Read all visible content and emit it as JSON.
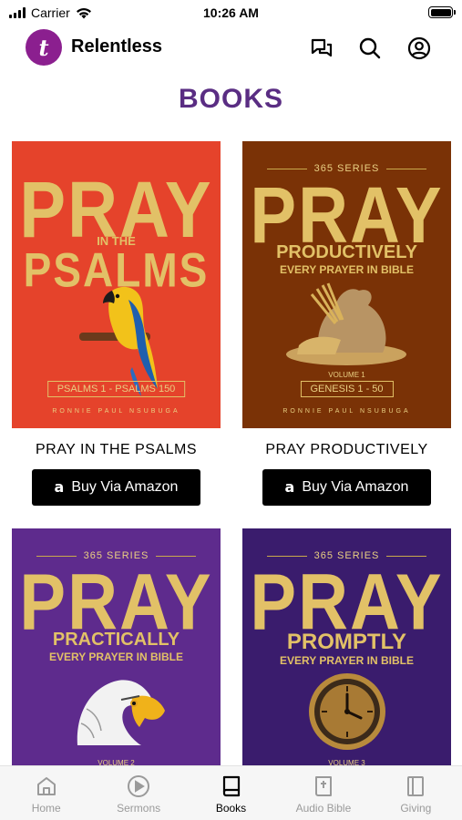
{
  "status_bar": {
    "carrier": "Carrier",
    "time": "10:26 AM"
  },
  "header": {
    "app_name": "Relentless",
    "logo_glyph": "t"
  },
  "page": {
    "title": "BOOKS"
  },
  "books": [
    {
      "title": "PRAY IN THE PSALMS",
      "button": "Buy Via Amazon",
      "cover": {
        "bg": "#e5432b",
        "series": "",
        "word": "PRAY",
        "subtitle": "IN THE",
        "subtitle2": "PSALMS",
        "volume": "",
        "range": "PSALMS 1 - PSALMS 150",
        "author": "RONNIE PAUL NSUBUGA",
        "art": "parrot-icon"
      }
    },
    {
      "title": "PRAY PRODUCTIVELY",
      "button": "Buy Via Amazon",
      "cover": {
        "bg": "#7a3206",
        "series": "365 SERIES",
        "word": "PRAY",
        "subtitle": "PRODUCTIVELY",
        "subtitle2": "EVERY PRAYER IN BIBLE",
        "volume": "VOLUME 1",
        "range": "GENESIS 1 - 50",
        "author": "RONNIE PAUL NSUBUGA",
        "art": "grain-sack-icon"
      }
    },
    {
      "title": "",
      "button": "",
      "cover": {
        "bg": "#5e2b8d",
        "series": "365 SERIES",
        "word": "PRAY",
        "subtitle": "PRACTICALLY",
        "subtitle2": "EVERY PRAYER IN BIBLE",
        "volume": "VOLUME 2",
        "range": "",
        "author": "",
        "art": "eagle-icon"
      }
    },
    {
      "title": "",
      "button": "",
      "cover": {
        "bg": "#3a1c6d",
        "series": "365 SERIES",
        "word": "PRAY",
        "subtitle": "PROMPTLY",
        "subtitle2": "EVERY PRAYER IN BIBLE",
        "volume": "VOLUME 3",
        "range": "",
        "author": "",
        "art": "clock-icon"
      }
    }
  ],
  "tabs": [
    {
      "label": "Home",
      "icon": "home-icon",
      "active": false
    },
    {
      "label": "Sermons",
      "icon": "play-circle-icon",
      "active": false
    },
    {
      "label": "Books",
      "icon": "book-icon",
      "active": true
    },
    {
      "label": "Audio Bible",
      "icon": "bible-icon",
      "active": false
    },
    {
      "label": "Giving",
      "icon": "giving-icon",
      "active": false
    }
  ],
  "colors": {
    "title_purple": "#5a2d83",
    "logo_purple": "#8b1f8f",
    "gold": "#e2c167"
  }
}
